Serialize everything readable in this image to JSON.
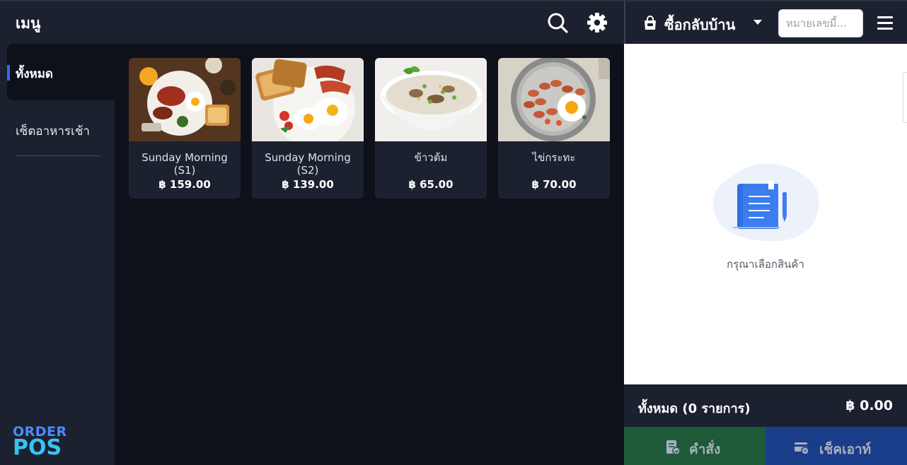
{
  "header": {
    "title": "เมนู"
  },
  "icons": {
    "search": "search-icon",
    "settings": "gear-icon",
    "menu": "hamburger-icon",
    "order_type": "shopping-bag-icon"
  },
  "sidebar": {
    "items": [
      {
        "label": "ทั้งหมด",
        "active": true
      },
      {
        "label": "เซ็ตอาหารเช้า",
        "active": false
      }
    ]
  },
  "brand": {
    "line1": "ORDER",
    "line2": "POS"
  },
  "products": [
    {
      "name": "Sunday Morning (S1)",
      "price": "฿ 159.00",
      "image": "breakfast-plate"
    },
    {
      "name": "Sunday Morning (S2)",
      "price": "฿ 139.00",
      "image": "toast-eggs-bacon"
    },
    {
      "name": "ข้าวต้ม",
      "price": "฿ 65.00",
      "image": "rice-porridge"
    },
    {
      "name": "ไข่กระทะ",
      "price": "฿ 70.00",
      "image": "pan-eggs-sausage"
    }
  ],
  "order": {
    "type_label": "ซื้อกลับบ้าน",
    "table_placeholder": "หมายเลขมี้...",
    "empty_message": "กรุณาเลือกสินค้า",
    "total_label": "ทั้งหมด (0 รายการ)",
    "total_amount": "฿ 0.00"
  },
  "actions": {
    "order_label": "คำสั่ง",
    "checkout_label": "เช็คเอาท์"
  },
  "colors": {
    "accent": "#2e6bff",
    "order_button": "#1e5a37",
    "checkout_button": "#1a3d8a",
    "panel": "#1c2130",
    "background": "#0f111a"
  }
}
